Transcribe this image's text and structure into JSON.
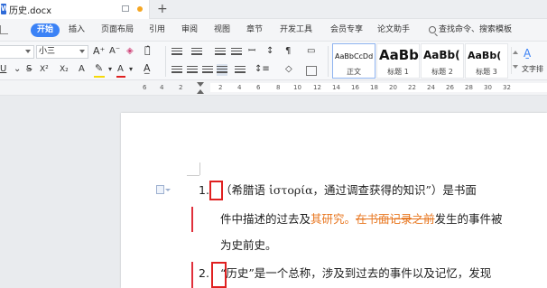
{
  "tab": {
    "doc_name": "历史.docx"
  },
  "menu": {
    "items": [
      "开始",
      "插入",
      "页面布局",
      "引用",
      "审阅",
      "视图",
      "章节",
      "开发工具",
      "会员专享",
      "论文助手"
    ],
    "search_placeholder": "查找命令、搜索模板"
  },
  "ribbon": {
    "font_name": "",
    "font_size": "小三",
    "style_gallery": [
      {
        "sample": "AaBbCcDd",
        "label": "正文"
      },
      {
        "sample": "AaBb",
        "label": "标题 1"
      },
      {
        "sample": "AaBb(",
        "label": "标题 2"
      },
      {
        "sample": "AaBb(",
        "label": "标题 3"
      }
    ],
    "text_tools_label": "文字排",
    "format_buttons": [
      "U",
      "X²",
      "X₂",
      "A",
      "A"
    ],
    "colors": {
      "highlight": "#f5d90a",
      "font_color": "#e02020",
      "accent": "#3b82f6"
    }
  },
  "ruler": {
    "numbers": [
      "6",
      "4",
      "2",
      "2",
      "4",
      "6",
      "8",
      "10",
      "12",
      "14",
      "16",
      "18",
      "20",
      "22",
      "24",
      "26",
      "28",
      "30",
      "32"
    ]
  },
  "document": {
    "list": [
      {
        "number": "1.",
        "line1": "（希腊语 ἱστορία，通过调查获得的知识”）是书面",
        "line2_before": "件中描述的过去及",
        "line2_inserted": "其研究。",
        "line2_deleted": "在书面记录之前",
        "line2_after": "发生的事件被",
        "line3": "为史前史。"
      },
      {
        "number": "2.",
        "line1": "“历史”是一个总称，涉及到过去的事件以及记忆，发现"
      }
    ]
  }
}
